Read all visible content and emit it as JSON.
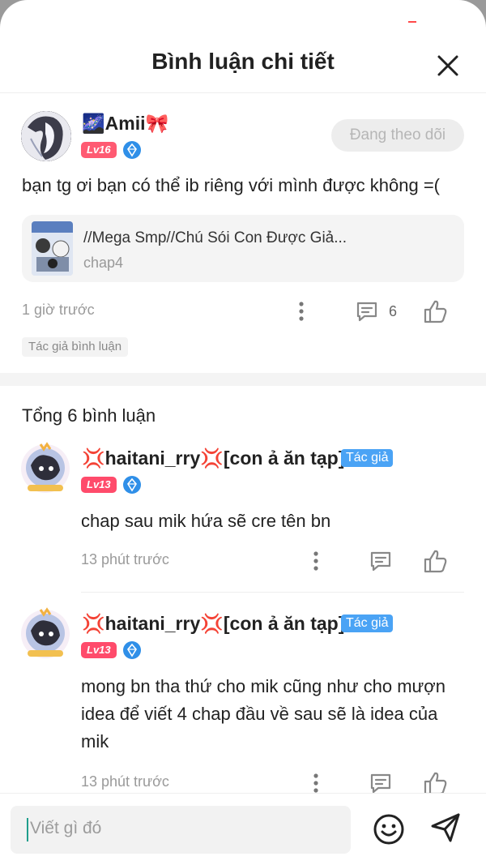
{
  "header": {
    "title": "Bình luận chi tiết"
  },
  "main_comment": {
    "username": "🌌Amii🎀",
    "level": "Lv16",
    "follow_label": "Đang theo dõi",
    "text": "bạn tg ơi bạn có thể ib riêng với mình được không =(",
    "story": {
      "title": "//Mega Smp//Chú Sói Con Được Giả...",
      "chapter": "chap4"
    },
    "time": "1 giờ trước",
    "reply_count": "6",
    "tag": "Tác giả bình luận"
  },
  "replies_section": {
    "total": "Tổng 6 bình luận",
    "items": [
      {
        "username": "💢haitani_rry💢[con ả ăn tạp]",
        "author_badge": "Tác giả",
        "level": "Lv13",
        "text": "chap sau mik hứa sẽ cre tên bn",
        "time": "13 phút trước"
      },
      {
        "username": "💢haitani_rry💢[con ả ăn tạp]",
        "author_badge": "Tác giả",
        "level": "Lv13",
        "text": "mong bn tha thứ cho mik cũng như cho mượn idea để viết 4 chap đầu về sau sẽ là idea của mik",
        "time": "13 phút trước"
      }
    ]
  },
  "composer": {
    "placeholder": "Viết gì đó"
  },
  "colors": {
    "level_badge": "#ff5a72",
    "author_badge": "#4aa3f5",
    "gem": "#2f8fe8",
    "caret": "#1f9e8c"
  },
  "icons": [
    "close-icon",
    "more-vertical-icon",
    "comment-icon",
    "thumbs-up-icon",
    "emoji-icon",
    "send-icon",
    "gem-icon"
  ]
}
